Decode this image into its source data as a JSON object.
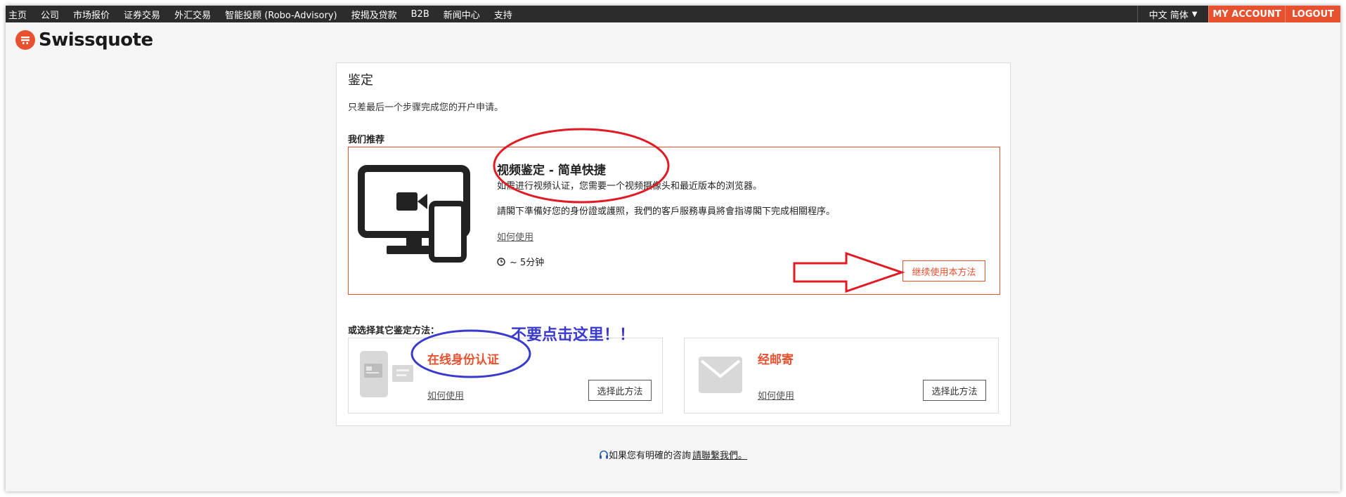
{
  "nav": {
    "items": [
      "主页",
      "公司",
      "市场报价",
      "证券交易",
      "外汇交易",
      "智能投顾 (Robo-Advisory)",
      "按揭及贷款",
      "B2B",
      "新闻中心",
      "支持"
    ],
    "language": "中文 简体",
    "my_account": "MY ACCOUNT",
    "logout": "LOGOUT"
  },
  "logo": {
    "text": "Swissquote"
  },
  "card": {
    "title": "鉴定",
    "subtitle": "只差最后一个步骤完成您的开户申请。",
    "recommend_label": "我们推荐",
    "video": {
      "title": "视频鉴定 - 简单快捷",
      "line1": "如需进行视频认证，您需要一个视频摄像头和最近版本的浏览器。",
      "line2": "請閣下準備好您的身份證或護照，我們的客戶服務專員將會指導閣下完成相關程序。",
      "howto": "如何使用",
      "duration": "~ 5分钟",
      "continue": "继续使用本方法"
    },
    "other_label": "或选择其它鉴定方法：",
    "online": {
      "title": "在线身份认证",
      "howto": "如何使用",
      "select": "选择此方法"
    },
    "mail": {
      "title": "经邮寄",
      "howto": "如何使用",
      "select": "选择此方法"
    }
  },
  "help": {
    "text": "如果您有明確的咨詢",
    "link": "請聯繫我們。"
  },
  "annotation": {
    "warning": "不要点击这里！！"
  },
  "colors": {
    "accent": "#e8512f",
    "nav_bg": "#2c2c2c",
    "annotation_red": "#e01b24",
    "annotation_blue": "#3a3acd"
  }
}
